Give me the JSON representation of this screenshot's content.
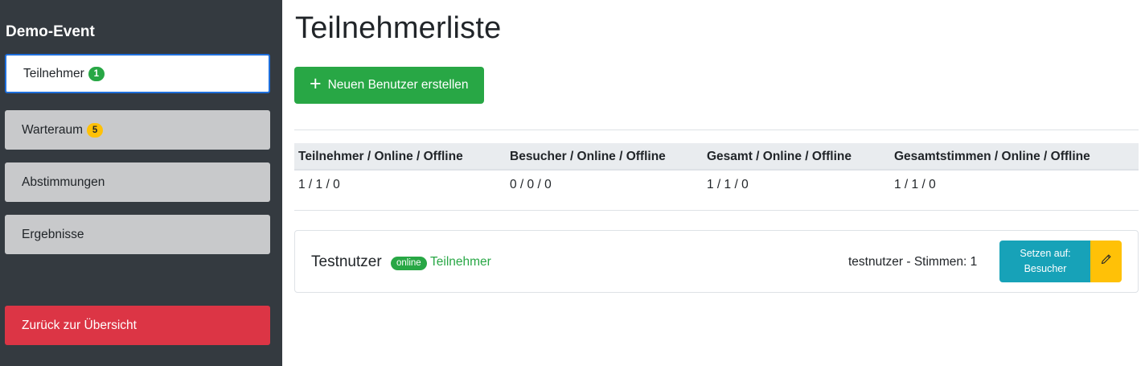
{
  "sidebar": {
    "event_title": "Demo-Event",
    "items": [
      {
        "label": "Teilnehmer",
        "badge": "1",
        "badge_color": "#28a745",
        "active": true
      },
      {
        "label": "Warteraum",
        "badge": "5",
        "badge_color": "#ffc107",
        "active": false
      },
      {
        "label": "Abstimmungen"
      },
      {
        "label": "Ergebnisse"
      }
    ],
    "back_label": "Zurück zur Übersicht"
  },
  "main": {
    "title": "Teilnehmerliste",
    "create_button": {
      "icon": "plus-icon",
      "label": "Neuen Benutzer erstellen"
    },
    "stats": {
      "headers": [
        "Teilnehmer / Online / Offline",
        "Besucher / Online / Offline",
        "Gesamt / Online / Offline",
        "Gesamtstimmen / Online / Offline"
      ],
      "values": [
        "1 / 1 / 0",
        "0 / 0 / 0",
        "1 / 1 / 0",
        "1 / 1 / 0"
      ]
    },
    "users": [
      {
        "name": "Testnutzer",
        "status": "online",
        "role": "Teilnehmer",
        "vote_info": "testnutzer - Stimmen: 1",
        "set_button": "Setzen auf: Besucher",
        "edit_icon": "pencil-icon"
      }
    ]
  },
  "colors": {
    "sidebar_bg": "#343a40",
    "success": "#28a745",
    "danger": "#dc3545",
    "info": "#17a2b8",
    "warning": "#ffc107",
    "active_border": "#1e6fdc"
  }
}
